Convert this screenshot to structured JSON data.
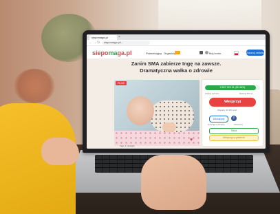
{
  "browser": {
    "tab_title": "siepomaga.pl",
    "tab_close": "×",
    "url": "siepomaga.pl/...",
    "back_icon": "arrow-left-icon",
    "forward_icon": "arrow-right-icon",
    "reload_icon": "reload-icon"
  },
  "site": {
    "logo_part1": "siepo",
    "logo_part2": "ma",
    "logo_part3": "ga.pl",
    "nav": [
      "Potrzebujący",
      "Organizuj"
    ],
    "user_label": "Mój konto",
    "cta_label": "Zacznij zbiórkę",
    "brand_red": "#e84142",
    "brand_green": "#2aa84a",
    "brand_blue": "#1d6fd1"
  },
  "fundraiser": {
    "headline": "Zanim SMA zabierze Ingę na zawsze. Dramatyczna walka o zdrowie",
    "progress_fraction": 0.92,
    "progress_text": "9 897 325 ZŁ (92.46%)",
    "raised_label": "Wpłaty zebrane",
    "remaining_label": "Brakuje 804 zł",
    "donate_label": "Wesprzyj",
    "donate_sub": "Wsparło 34 495 osób",
    "share_label": "Udostępnij",
    "fb_icon": "f",
    "helper_left": "Udostępnij zbiórkę",
    "helper_right": "Obserwuj",
    "watch_label": "Śledź",
    "promo_label": "Wesprzyj w pakiecie",
    "photo_badge": "PILNE",
    "photo_caption": "Inga, 4 miesiące"
  }
}
